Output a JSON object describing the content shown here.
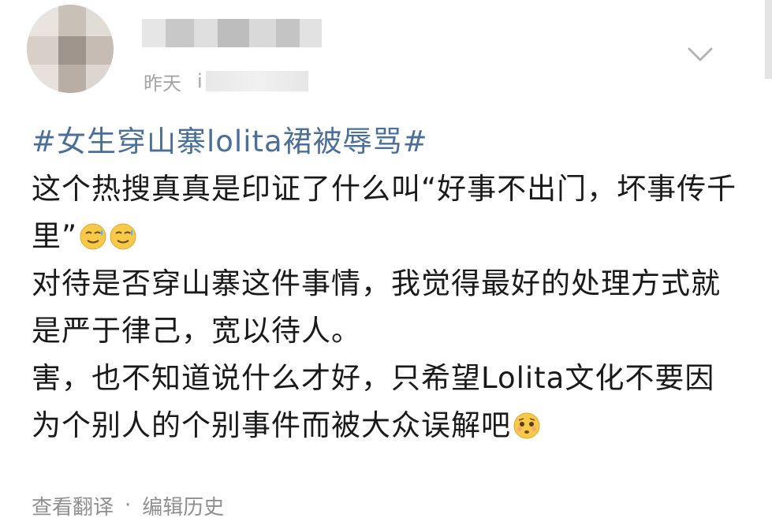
{
  "post": {
    "time": "昨天",
    "source_prefix": "i",
    "topic": "#女生穿山寨lolita裙被辱骂#",
    "paragraphs": [
      "这个热搜真真是印证了什么叫“好事不出门，坏事传千里”",
      "对待是否穿山寨这件事情，我觉得最好的处理方式就是严于律己，宽以待人。",
      "害，也不知道说什么才好，只希望Lolita文化不要因为个别人的个别事件而被大众误解吧"
    ]
  },
  "footer": {
    "translate": "查看翻译",
    "separator": "·",
    "edit_history": "编辑历史"
  },
  "icons": {
    "expand": "chevron-down-icon",
    "emoji_1": "sweat-smile-emoji",
    "emoji_2": "sweat-smile-emoji",
    "emoji_3": "worried-emoji"
  },
  "colors": {
    "topic": "#4a6f9a",
    "text": "#1a1a1a",
    "meta": "#a4a4a4"
  }
}
